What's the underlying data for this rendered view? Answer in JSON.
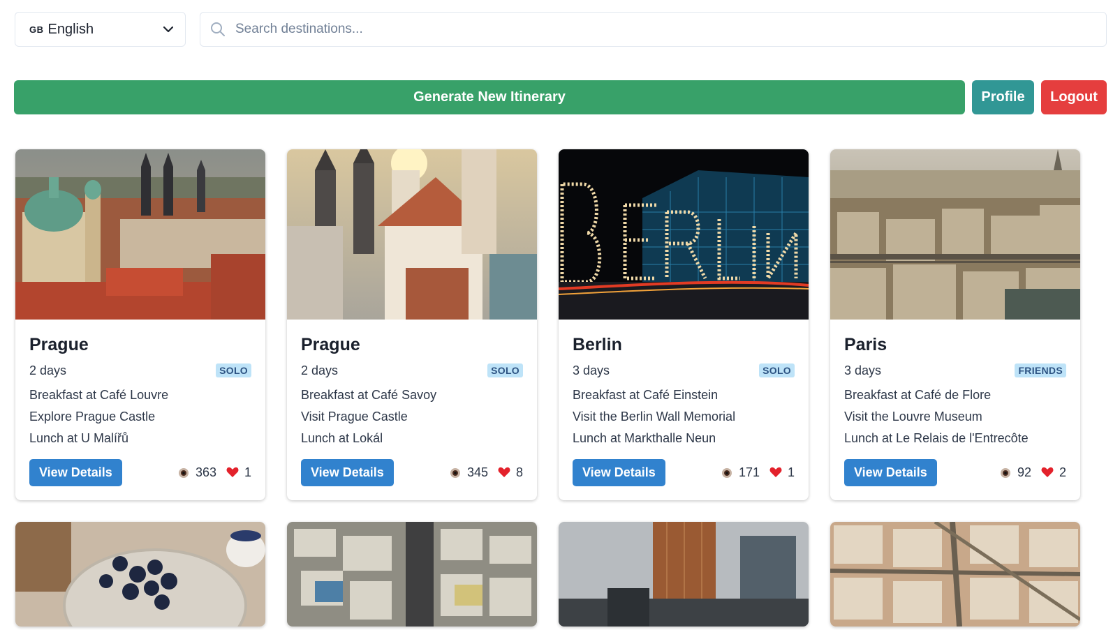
{
  "language": {
    "flag": "GB",
    "label": "English"
  },
  "search": {
    "placeholder": "Search destinations..."
  },
  "actions": {
    "generate": "Generate New Itinerary",
    "profile": "Profile",
    "logout": "Logout"
  },
  "cards": [
    {
      "city": "Prague",
      "days": "2 days",
      "type": "SOLO",
      "activities": [
        "Breakfast at Café Louvre",
        "Explore Prague Castle",
        "Lunch at U Malířů"
      ],
      "view_label": "View Details",
      "views": "363",
      "likes": "1"
    },
    {
      "city": "Prague",
      "days": "2 days",
      "type": "SOLO",
      "activities": [
        "Breakfast at Café Savoy",
        "Visit Prague Castle",
        "Lunch at Lokál"
      ],
      "view_label": "View Details",
      "views": "345",
      "likes": "8"
    },
    {
      "city": "Berlin",
      "days": "3 days",
      "type": "SOLO",
      "activities": [
        "Breakfast at Café Einstein",
        "Visit the Berlin Wall Memorial",
        "Lunch at Markthalle Neun"
      ],
      "view_label": "View Details",
      "views": "171",
      "likes": "1"
    },
    {
      "city": "Paris",
      "days": "3 days",
      "type": "FRIENDS",
      "activities": [
        "Breakfast at Café de Flore",
        "Visit the Louvre Museum",
        "Lunch at Le Relais de l'Entrecôte"
      ],
      "view_label": "View Details",
      "views": "92",
      "likes": "2"
    }
  ],
  "colors": {
    "generate": "#38a169",
    "profile": "#319795",
    "logout": "#e53e3e",
    "view": "#3182ce",
    "badge_bg": "#bee3f8",
    "badge_text": "#2c5282"
  }
}
